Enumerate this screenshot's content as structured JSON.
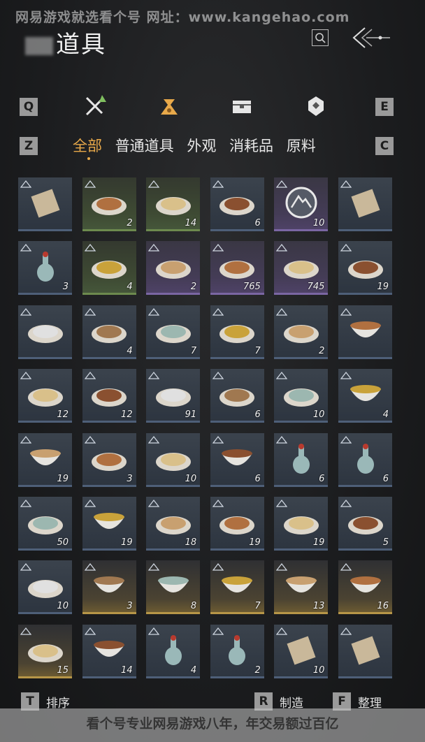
{
  "watermark_top": "网易游戏就选看个号   网址：www.kangehao.com",
  "watermark_bottom": "看个号专业网易游戏八年，年交易额过百亿",
  "header": {
    "title": "道具"
  },
  "keys": {
    "prev_category": "Q",
    "next_category": "E",
    "prev_sub": "Z",
    "next_sub": "C",
    "sort": "T",
    "craft": "R",
    "organize": "F"
  },
  "category_icons": [
    "weapon-icon",
    "bag-icon",
    "chest-icon",
    "badge-icon"
  ],
  "subtabs": [
    "全部",
    "普通道具",
    "外观",
    "消耗品",
    "原料"
  ],
  "bottom": {
    "sort_label": "排序",
    "craft_label": "制造",
    "organize_label": "整理"
  },
  "items": [
    {
      "icon": "scroll-icon",
      "rarity": "blue",
      "count": ""
    },
    {
      "icon": "stir-fry-dish-icon",
      "rarity": "green",
      "count": "2"
    },
    {
      "icon": "stew-pot-icon",
      "rarity": "green",
      "count": "14"
    },
    {
      "icon": "soup-pot-icon",
      "rarity": "blue",
      "count": "6"
    },
    {
      "icon": "mountain-emblem-icon",
      "rarity": "purple",
      "count": "10"
    },
    {
      "icon": "book-icon",
      "rarity": "blue",
      "count": ""
    },
    {
      "icon": "vase-icon",
      "rarity": "blue",
      "count": "3"
    },
    {
      "icon": "dumplings-icon",
      "rarity": "green",
      "count": "4"
    },
    {
      "icon": "pastry-plate-icon",
      "rarity": "purple",
      "count": "2"
    },
    {
      "icon": "braised-dish-icon",
      "rarity": "purple",
      "count": "765"
    },
    {
      "icon": "fried-food-icon",
      "rarity": "purple",
      "count": "745"
    },
    {
      "icon": "sliced-meat-icon",
      "rarity": "blue",
      "count": "19"
    },
    {
      "icon": "cake-icon",
      "rarity": "blue",
      "count": ""
    },
    {
      "icon": "fish-plate-icon",
      "rarity": "blue",
      "count": "4"
    },
    {
      "icon": "hot-soup-icon",
      "rarity": "blue",
      "count": "7"
    },
    {
      "icon": "seafood-plate-icon",
      "rarity": "blue",
      "count": "7"
    },
    {
      "icon": "oyster-plate-icon",
      "rarity": "blue",
      "count": "2"
    },
    {
      "icon": "berry-bowl-icon",
      "rarity": "blue",
      "count": ""
    },
    {
      "icon": "wine-cup-icon",
      "rarity": "blue",
      "count": "12"
    },
    {
      "icon": "noodle-plate-icon",
      "rarity": "blue",
      "count": "12"
    },
    {
      "icon": "meat-plate-icon",
      "rarity": "blue",
      "count": "91"
    },
    {
      "icon": "greens-plate-icon",
      "rarity": "blue",
      "count": "6"
    },
    {
      "icon": "noodle-soup-icon",
      "rarity": "blue",
      "count": "10"
    },
    {
      "icon": "congee-bowl-icon",
      "rarity": "blue",
      "count": "4"
    },
    {
      "icon": "porridge-bowl-icon",
      "rarity": "blue",
      "count": "19"
    },
    {
      "icon": "tofu-plate-icon",
      "rarity": "blue",
      "count": "3"
    },
    {
      "icon": "shredded-meat-icon",
      "rarity": "blue",
      "count": "10"
    },
    {
      "icon": "rice-bowl-icon",
      "rarity": "blue",
      "count": "6"
    },
    {
      "icon": "porcelain-bottle-icon",
      "rarity": "blue",
      "count": "6"
    },
    {
      "icon": "porcelain-bottle-icon",
      "rarity": "blue",
      "count": "6"
    },
    {
      "icon": "fried-noodles-icon",
      "rarity": "blue",
      "count": "50"
    },
    {
      "icon": "spicy-bowl-icon",
      "rarity": "blue",
      "count": "19"
    },
    {
      "icon": "roast-meat-icon",
      "rarity": "blue",
      "count": "18"
    },
    {
      "icon": "meatballs-icon",
      "rarity": "blue",
      "count": "19"
    },
    {
      "icon": "golden-cubes-icon",
      "rarity": "blue",
      "count": "19"
    },
    {
      "icon": "layered-cake-icon",
      "rarity": "blue",
      "count": "5"
    },
    {
      "icon": "stuffed-bun-icon",
      "rarity": "blue",
      "count": "10"
    },
    {
      "icon": "painted-bowl-icon",
      "rarity": "gold",
      "count": "3"
    },
    {
      "icon": "painted-bowl-icon",
      "rarity": "gold",
      "count": "8"
    },
    {
      "icon": "rooster-bowl-icon",
      "rarity": "gold",
      "count": "7"
    },
    {
      "icon": "white-bowl-icon",
      "rarity": "gold",
      "count": "13"
    },
    {
      "icon": "lidded-bowl-icon",
      "rarity": "gold",
      "count": "16"
    },
    {
      "icon": "plate-icon",
      "rarity": "gold",
      "count": "15"
    },
    {
      "icon": "deep-bowl-icon",
      "rarity": "blue",
      "count": "14"
    },
    {
      "icon": "celadon-jar-icon",
      "rarity": "blue",
      "count": "4"
    },
    {
      "icon": "celadon-jar-icon",
      "rarity": "blue",
      "count": "2"
    },
    {
      "icon": "wooden-plank-icon",
      "rarity": "blue",
      "count": "10"
    },
    {
      "icon": "map-scroll-icon",
      "rarity": "blue",
      "count": ""
    }
  ]
}
